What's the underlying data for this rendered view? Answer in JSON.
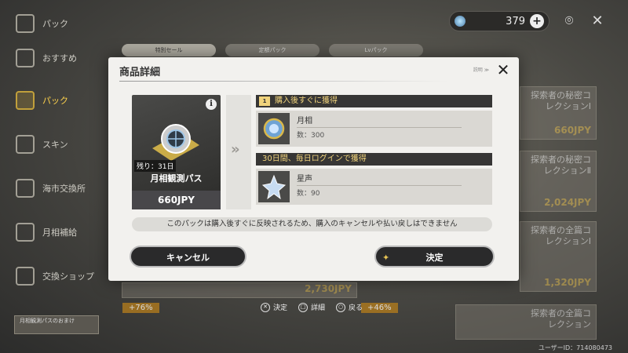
{
  "sidebar": {
    "items": [
      {
        "label": "パック"
      },
      {
        "label": "おすすめ"
      },
      {
        "label": "パック"
      },
      {
        "label": "スキン"
      },
      {
        "label": "海市交換所"
      },
      {
        "label": "月相補給"
      },
      {
        "label": "交換ショップ"
      }
    ],
    "footer_text": "月相観測パスのおまけ"
  },
  "top_bar": {
    "currency_amount": "379",
    "plus": "+"
  },
  "tabs": [
    {
      "label": "特別セール"
    },
    {
      "label": "定額パック"
    },
    {
      "label": "Lvパック"
    }
  ],
  "bg_cards": [
    {
      "name": "探索者の秘密コレクションⅠ",
      "price": "660JPY"
    },
    {
      "name": "探索者の秘密コレクションⅡ",
      "price": "2,024JPY"
    },
    {
      "name": "探索者の全篇コレクションⅠ",
      "price": "1,320JPY"
    },
    {
      "name": "探索者の全篇コレクション",
      "price": ""
    }
  ],
  "bg_price_left": "2,730JPY",
  "bg_pct": [
    "+76%",
    "+46%"
  ],
  "modal": {
    "title": "商品詳細",
    "header_small": "説明 ≫",
    "close": "✕",
    "pass": {
      "info": "i",
      "remaining": "残り：31日",
      "name": "月相観測パス",
      "price": "660JPY"
    },
    "arrow": "»",
    "section_immediate": {
      "badge": "1",
      "label": "購入後すぐに獲得",
      "item_name": "月相",
      "item_qty": "数：300"
    },
    "section_daily": {
      "label": "30日間、毎日ログインで獲得",
      "item_name": "星声",
      "item_qty": "数：90"
    },
    "notice": "このパックは購入後すぐに反映されるため、購入のキャンセルや払い戻しはできません",
    "cancel_label": "キャンセル",
    "confirm_label": "決定"
  },
  "hints": [
    {
      "btn": "✕",
      "label": "決定"
    },
    {
      "btn": "□",
      "label": "詳細"
    },
    {
      "btn": "○",
      "label": "戻る"
    }
  ],
  "user_id": "ユーザーID：714080473"
}
